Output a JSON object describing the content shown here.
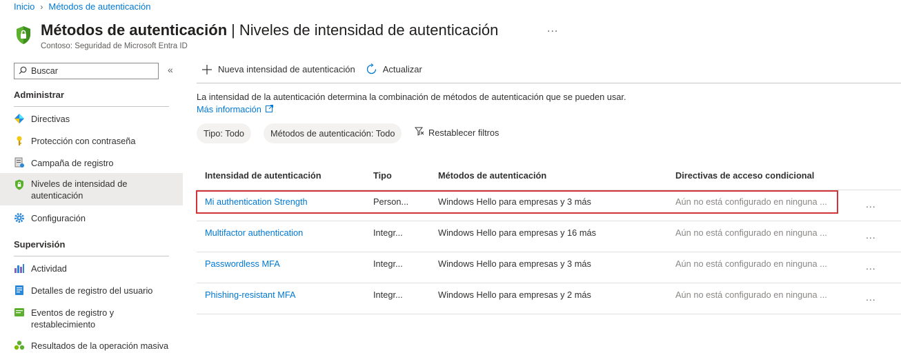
{
  "breadcrumb": {
    "home": "Inicio",
    "current": "Métodos de autenticación"
  },
  "header": {
    "title": "Métodos de autenticación",
    "separator": "|",
    "subtitle_title": "Niveles de intensidad de autenticación",
    "more": "...",
    "org": "Contoso: Seguridad de Microsoft Entra ID"
  },
  "sidebar": {
    "search_placeholder": "Buscar",
    "collapse": "«",
    "sections": [
      {
        "label": "Administrar"
      },
      {
        "label": "Supervisión"
      }
    ],
    "items": [
      {
        "label": "Directivas",
        "icon": "policies-icon"
      },
      {
        "label": "Protección con contraseña",
        "icon": "key-icon"
      },
      {
        "label": "Campaña de registro",
        "icon": "registration-campaign-icon"
      },
      {
        "label": "Niveles de intensidad de autenticación",
        "icon": "shield-icon",
        "active": true
      },
      {
        "label": "Configuración",
        "icon": "gear-icon"
      },
      {
        "label": "Actividad",
        "icon": "activity-chart-icon"
      },
      {
        "label": "Detalles de registro del usuario",
        "icon": "user-details-icon"
      },
      {
        "label": "Eventos de registro y restablecimiento",
        "icon": "events-icon"
      },
      {
        "label": "Resultados de la operación masiva",
        "icon": "bulk-results-icon"
      }
    ]
  },
  "toolbar": {
    "new_label": "Nueva intensidad de autenticación",
    "refresh_label": "Actualizar"
  },
  "main": {
    "description": "La intensidad de la autenticación determina la combinación de métodos de autenticación que se pueden usar.",
    "learn_more": "Más información",
    "filters": {
      "type": "Tipo: Todo",
      "methods": "Métodos de autenticación: Todo",
      "reset": "Restablecer filtros"
    }
  },
  "table": {
    "columns": [
      "Intensidad de autenticación",
      "Tipo",
      "Métodos de autenticación",
      "Directivas de acceso condicional"
    ],
    "rows": [
      {
        "name": "Mi authentication Strength",
        "type": "Person...",
        "methods": "Windows Hello para empresas y 3 más",
        "policies": "Aún no está configurado en ninguna ...",
        "more": "..."
      },
      {
        "name": "Multifactor authentication",
        "type": "Integr...",
        "methods": "Windows Hello para empresas y 16 más",
        "policies": "Aún no está configurado en ninguna ...",
        "more": "..."
      },
      {
        "name": "Passwordless MFA",
        "type": "Integr...",
        "methods": "Windows Hello para empresas y 3 más",
        "policies": "Aún no está configurado en ninguna ...",
        "more": "..."
      },
      {
        "name": "Phishing-resistant MFA",
        "type": "Integr...",
        "methods": "Windows Hello para empresas y 2 más",
        "policies": "Aún no está configurado en ninguna ...",
        "more": "..."
      }
    ]
  },
  "colors": {
    "accent": "#0078d4",
    "highlight": "#d13438",
    "shield": "#5bb02d"
  }
}
